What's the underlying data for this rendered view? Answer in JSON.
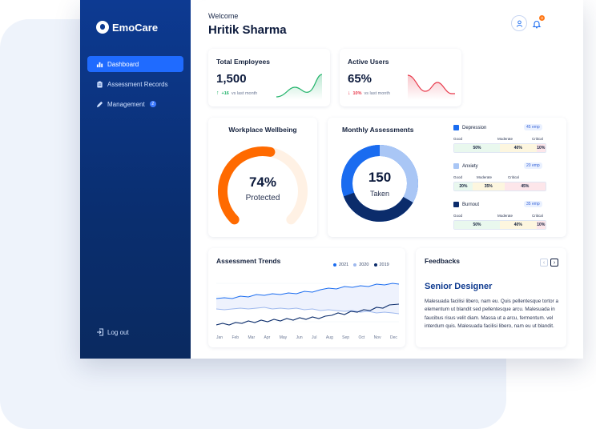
{
  "app": {
    "name": "EmoCare"
  },
  "sidebar": {
    "items": [
      {
        "label": "Dashboard",
        "icon": "bar-chart-icon",
        "active": true
      },
      {
        "label": "Assessment Records",
        "icon": "clipboard-icon",
        "active": false
      },
      {
        "label": "Management",
        "icon": "pencil-icon",
        "active": false,
        "badge": "2"
      }
    ],
    "logout_label": "Log out"
  },
  "header": {
    "welcome": "Welcome",
    "user_name": "Hritik Sharma",
    "notification_count": "3"
  },
  "stats": [
    {
      "title": "Total Employees",
      "value": "1,500",
      "delta": "+16",
      "delta_note": "vs last month",
      "trend": "up",
      "color": "#21b36a"
    },
    {
      "title": "Active Users",
      "value": "65%",
      "delta": "10%",
      "delta_note": "vs last month",
      "trend": "down",
      "color": "#e8394b"
    }
  ],
  "wellbeing": {
    "title": "Workplace Wellbeing",
    "percent": 74,
    "percent_label": "74%",
    "caption": "Protected",
    "colors": {
      "fill": "#ff6a00",
      "track": "#fff1e4"
    }
  },
  "monthly": {
    "title": "Monthly Assessments",
    "total": "150",
    "caption": "Taken",
    "donut": [
      {
        "name": "Depression",
        "share": 0.3,
        "color": "#1a6cf0"
      },
      {
        "name": "Anxiety",
        "share": 0.13,
        "color": "#a9c6f5"
      },
      {
        "name": "Burnout",
        "share": 0.23,
        "color": "#0b2c6b"
      }
    ],
    "levels": [
      "Good",
      "Moderate",
      "Critical"
    ],
    "categories": [
      {
        "name": "Depression",
        "count": "45 emp",
        "color": "#1a6cf0",
        "segments": [
          "50%",
          "40%",
          "10%"
        ],
        "fractions": [
          0.5,
          0.4,
          0.1
        ]
      },
      {
        "name": "Anxiety",
        "count": "20 emp",
        "color": "#a9c6f5",
        "segments": [
          "20%",
          "35%",
          "45%"
        ],
        "fractions": [
          0.2,
          0.35,
          0.45
        ]
      },
      {
        "name": "Burnout",
        "count": "35 emp",
        "color": "#0b2c6b",
        "segments": [
          "50%",
          "40%",
          "10%"
        ],
        "fractions": [
          0.5,
          0.4,
          0.1
        ]
      }
    ],
    "segment_colors": [
      "#e9f8ee",
      "#fdf6df",
      "#fde6ea"
    ]
  },
  "trends": {
    "title": "Assessment Trends",
    "legend": [
      {
        "label": "2021",
        "color": "#1a6cf0"
      },
      {
        "label": "2020",
        "color": "#9fb9ee"
      },
      {
        "label": "2019",
        "color": "#0b2c6b"
      }
    ],
    "months": [
      "Jan",
      "Feb",
      "Mar",
      "Apr",
      "May",
      "Jun",
      "Jul",
      "Aug",
      "Sep",
      "Oct",
      "Nov",
      "Dec"
    ]
  },
  "feedbacks": {
    "title": "Feedbacks",
    "role": "Senior Designer",
    "text": "Malesuada facilisi libero, nam eu. Quis pellentesque tortor a elementum ut blandit sed pellentesque arcu. Malesuada in faucibus risus velit diam. Massa ut a arcu, fermentum. vel interdum quis. Malesuada facilisi libero, nam eu ut blandit."
  }
}
